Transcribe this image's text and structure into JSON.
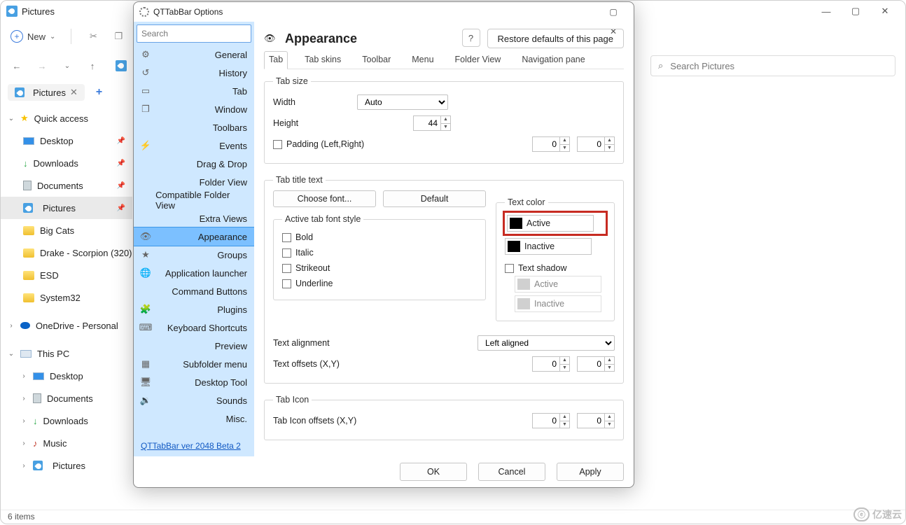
{
  "explorer": {
    "title": "Pictures",
    "new_label": "New",
    "search_placeholder": "Search Pictures",
    "tab_label": "Pictures",
    "status": "6 items",
    "quick_access": "Quick access",
    "this_pc": "This PC",
    "onedrive": "OneDrive - Personal",
    "qa_items": [
      "Desktop",
      "Downloads",
      "Documents",
      "Pictures",
      "Big Cats",
      "Drake - Scorpion (320)",
      "ESD",
      "System32"
    ],
    "pc_items": [
      "Desktop",
      "Documents",
      "Downloads",
      "Music",
      "Pictures"
    ]
  },
  "dialog": {
    "title": "QTTabBar Options",
    "search_placeholder": "Search",
    "version": "QTTabBar ver 2048 Beta 2",
    "categories": [
      "General",
      "History",
      "Tab",
      "Window",
      "Toolbars",
      "Events",
      "Drag & Drop",
      "Folder View",
      "Compatible Folder View",
      "Extra Views",
      "Appearance",
      "Groups",
      "Application launcher",
      "Command Buttons",
      "Plugins",
      "Keyboard Shortcuts",
      "Preview",
      "Subfolder menu",
      "Desktop Tool",
      "Sounds",
      "Misc."
    ],
    "selected_category": "Appearance",
    "heading": "Appearance",
    "restore": "Restore defaults of this page",
    "subtabs": [
      "Tab",
      "Tab skins",
      "Toolbar",
      "Menu",
      "Folder View",
      "Navigation pane"
    ],
    "subtab_selected": "Tab",
    "tabsize": {
      "legend": "Tab size",
      "width_label": "Width",
      "width_value": "Auto",
      "height_label": "Height",
      "height_value": "44",
      "padding_label": "Padding (Left,Right)",
      "pad_left": "0",
      "pad_right": "0"
    },
    "title_text": {
      "legend": "Tab title text",
      "choose_font": "Choose font...",
      "default": "Default",
      "active_style_legend": "Active tab font style",
      "styles": [
        "Bold",
        "Italic",
        "Strikeout",
        "Underline"
      ],
      "textcolor_legend": "Text color",
      "active": "Active",
      "inactive": "Inactive",
      "shadow": "Text shadow",
      "shadow_active": "Active",
      "shadow_inactive": "Inactive",
      "align_label": "Text alignment",
      "align_value": "Left aligned",
      "offsets_label": "Text offsets (X,Y)",
      "off_x": "0",
      "off_y": "0"
    },
    "tabicon": {
      "legend": "Tab Icon",
      "offsets_label": "Tab Icon offsets (X,Y)",
      "x": "0",
      "y": "0"
    },
    "buttons": {
      "ok": "OK",
      "cancel": "Cancel",
      "apply": "Apply"
    }
  },
  "watermark": "亿速云"
}
